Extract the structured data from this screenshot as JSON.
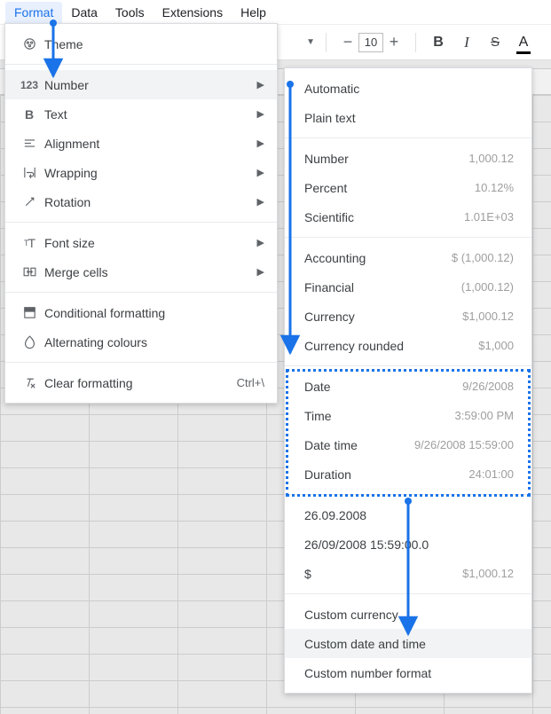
{
  "menubar": {
    "items": [
      "Format",
      "Data",
      "Tools",
      "Extensions",
      "Help"
    ],
    "active": "Format"
  },
  "toolbar": {
    "font_size": "10"
  },
  "format_menu": {
    "theme": "Theme",
    "number": "Number",
    "text": "Text",
    "alignment": "Alignment",
    "wrapping": "Wrapping",
    "rotation": "Rotation",
    "font_size": "Font size",
    "merge": "Merge cells",
    "cond": "Conditional formatting",
    "alt": "Alternating colours",
    "clear": "Clear formatting",
    "clear_shortcut": "Ctrl+\\"
  },
  "number_menu": {
    "automatic": {
      "label": "Automatic"
    },
    "plain": {
      "label": "Plain text"
    },
    "number": {
      "label": "Number",
      "example": "1,000.12"
    },
    "percent": {
      "label": "Percent",
      "example": "10.12%"
    },
    "scientific": {
      "label": "Scientific",
      "example": "1.01E+03"
    },
    "accounting": {
      "label": "Accounting",
      "example": "$ (1,000.12)"
    },
    "financial": {
      "label": "Financial",
      "example": "(1,000.12)"
    },
    "currency": {
      "label": "Currency",
      "example": "$1,000.12"
    },
    "currency_r": {
      "label": "Currency rounded",
      "example": "$1,000"
    },
    "date": {
      "label": "Date",
      "example": "9/26/2008"
    },
    "time": {
      "label": "Time",
      "example": "3:59:00 PM"
    },
    "datetime": {
      "label": "Date time",
      "example": "9/26/2008 15:59:00"
    },
    "duration": {
      "label": "Duration",
      "example": "24:01:00"
    },
    "p1": {
      "label": "26.09.2008"
    },
    "p2": {
      "label": "26/09/2008 15:59:00.0"
    },
    "p3": {
      "label": "$",
      "example": "$1,000.12"
    },
    "cust_cur": {
      "label": "Custom currency"
    },
    "cust_dt": {
      "label": "Custom date and time"
    },
    "cust_num": {
      "label": "Custom number format"
    }
  }
}
